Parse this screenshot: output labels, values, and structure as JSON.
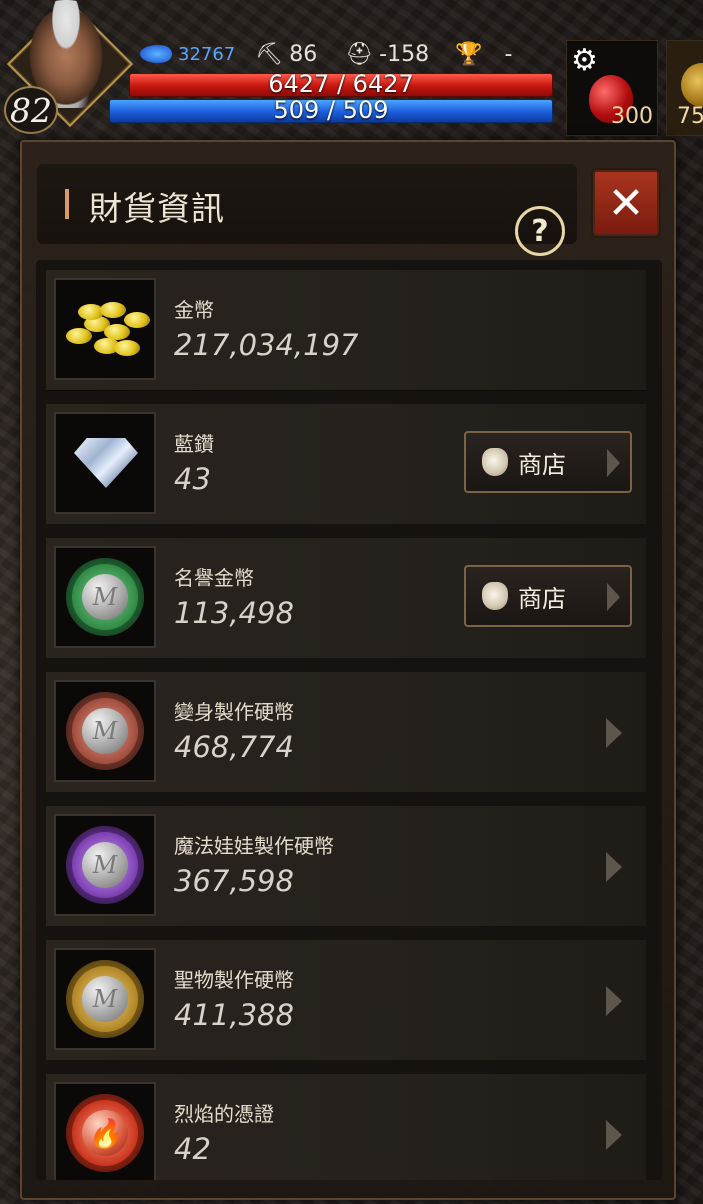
{
  "hud": {
    "level": "82",
    "stats": [
      {
        "icon": "stamina-icon",
        "value": "32767"
      },
      {
        "icon": "pickaxe-icon",
        "value": "86"
      },
      {
        "icon": "helmet-icon",
        "value": "-158"
      },
      {
        "icon": "trophy-icon",
        "value": "-"
      }
    ],
    "hp_text": "6427 / 6427",
    "hp_fraction": 1.0,
    "mp_text": "509 / 509",
    "mp_fraction": 1.0,
    "quick_slots": [
      {
        "icon": "health-potion-icon",
        "count": "300"
      },
      {
        "icon": "gold-sack-icon",
        "count": "75"
      }
    ]
  },
  "panel": {
    "title": "財貨資訊",
    "help_label": "?",
    "close_label": "✕",
    "shop_label": "商店",
    "items": [
      {
        "name": "金幣",
        "value": "217,034,197",
        "icon": "gold-coins-icon",
        "action": "none"
      },
      {
        "name": "藍鑽",
        "value": "43",
        "icon": "blue-diamond-icon",
        "action": "shop"
      },
      {
        "name": "名譽金幣",
        "value": "113,498",
        "icon": "honor-coin-icon",
        "action": "shop",
        "color": "#3c9a55"
      },
      {
        "name": "變身製作硬幣",
        "value": "468,774",
        "icon": "transform-coin-icon",
        "action": "chevron",
        "color": "#b8584a"
      },
      {
        "name": "魔法娃娃製作硬幣",
        "value": "367,598",
        "icon": "doll-coin-icon",
        "action": "chevron",
        "color": "#8d58c2"
      },
      {
        "name": "聖物製作硬幣",
        "value": "411,388",
        "icon": "relic-coin-icon",
        "action": "chevron",
        "color": "#c9a047"
      },
      {
        "name": "烈焰的憑證",
        "value": "42",
        "icon": "flame-token-icon",
        "action": "chevron",
        "color": "#d2452d"
      }
    ]
  }
}
